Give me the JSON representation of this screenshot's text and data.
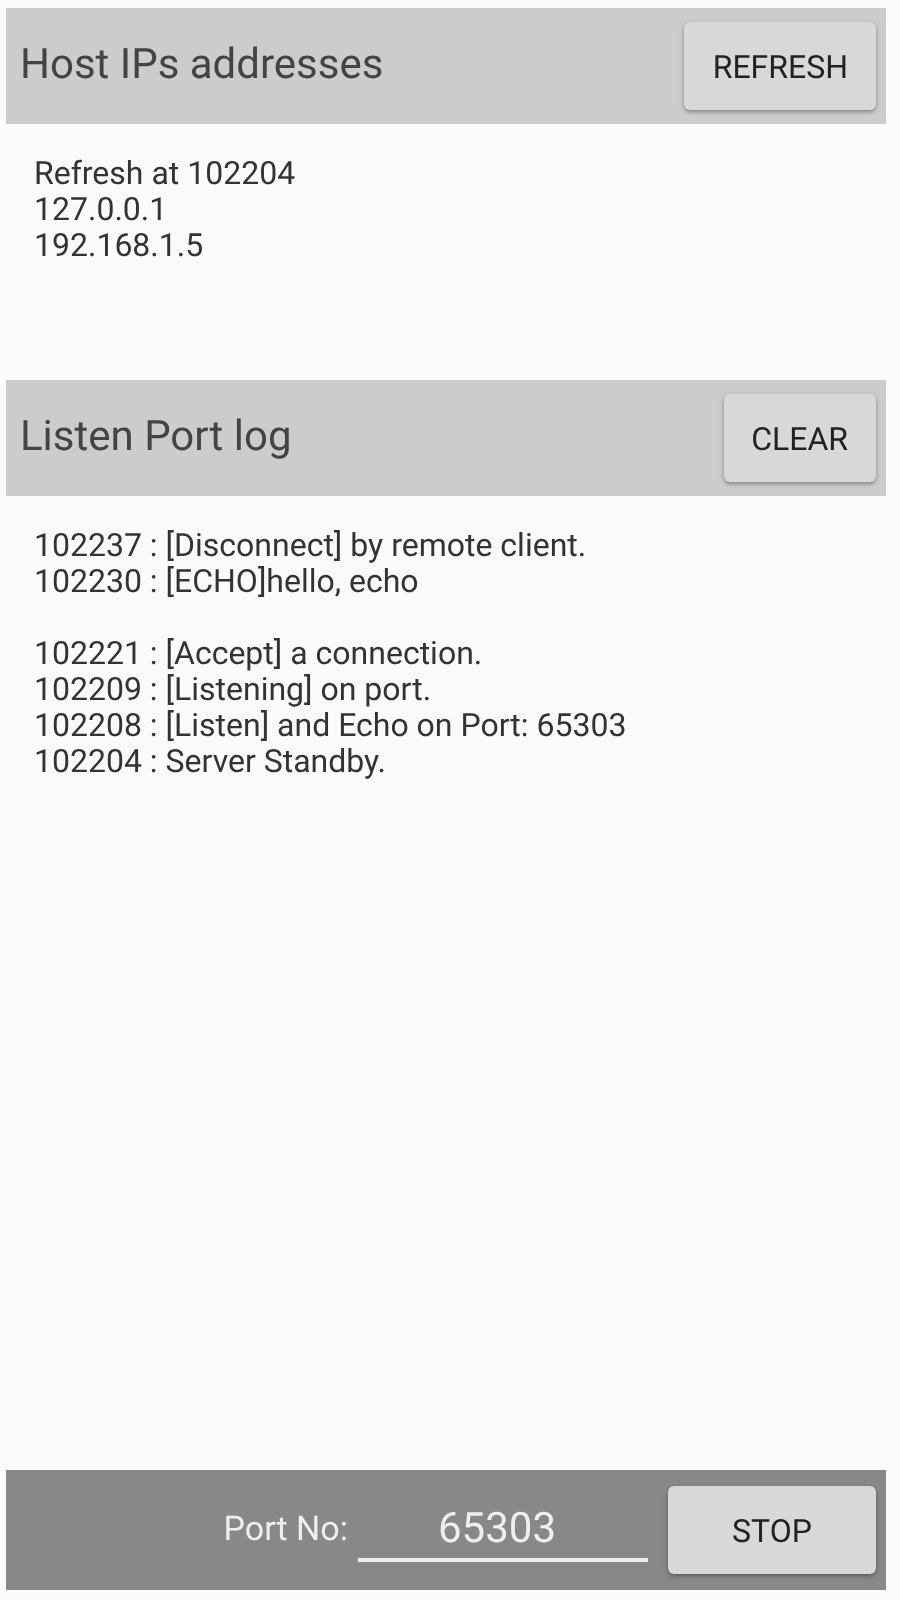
{
  "host_section": {
    "title": "Host IPs addresses",
    "button": "REFRESH",
    "lines": [
      "Refresh at 102204",
      "127.0.0.1",
      "192.168.1.5"
    ]
  },
  "log_section": {
    "title": "Listen Port log",
    "button": "CLEAR",
    "blocks": [
      [
        "102237 : [Disconnect] by remote client.",
        "102230 : [ECHO]hello, echo"
      ],
      [
        "102221 : [Accept] a connection.",
        "102209 : [Listening] on port.",
        "102208 : [Listen] and Echo on Port: 65303",
        "102204 : Server Standby."
      ]
    ]
  },
  "bottom_bar": {
    "label": "Port No:",
    "port_value": "65303",
    "button": "STOP"
  }
}
